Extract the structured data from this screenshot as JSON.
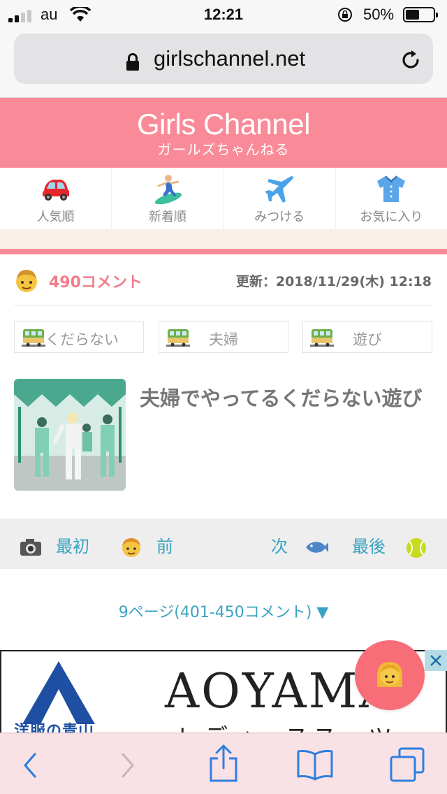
{
  "status_bar": {
    "carrier": "au",
    "time": "12:21",
    "battery_percent": "50%",
    "battery_level": 0.5
  },
  "browser": {
    "url": "girlschannel.net"
  },
  "site": {
    "logo": "Girls Channel",
    "logo_sub": "ガールズちゃんねる"
  },
  "nav": {
    "items": [
      {
        "label": "人気順",
        "icon": "car-icon"
      },
      {
        "label": "新着順",
        "icon": "surfer-icon"
      },
      {
        "label": "みつける",
        "icon": "airplane-icon"
      },
      {
        "label": "お気に入り",
        "icon": "shirt-icon"
      }
    ]
  },
  "topic": {
    "comment_count": "490コメント",
    "updated": "更新：2018/11/29(木) 12:18",
    "tags": [
      "くだらない",
      "夫婦",
      "遊び"
    ],
    "title": "夫婦でやってるくだらない遊び"
  },
  "pager": {
    "first": "最初",
    "prev": "前",
    "next": "次",
    "last": "最後",
    "page_select": "9ページ(401-450コメント) ▼"
  },
  "ad": {
    "brand": "AOYAMA",
    "subtitle": "レディーススーツ",
    "logo_text": "洋服の青山"
  },
  "colors": {
    "brand_pink": "#f98b98",
    "link_blue": "#3aa3c2",
    "toolbar_blue": "#2f7ee0"
  }
}
